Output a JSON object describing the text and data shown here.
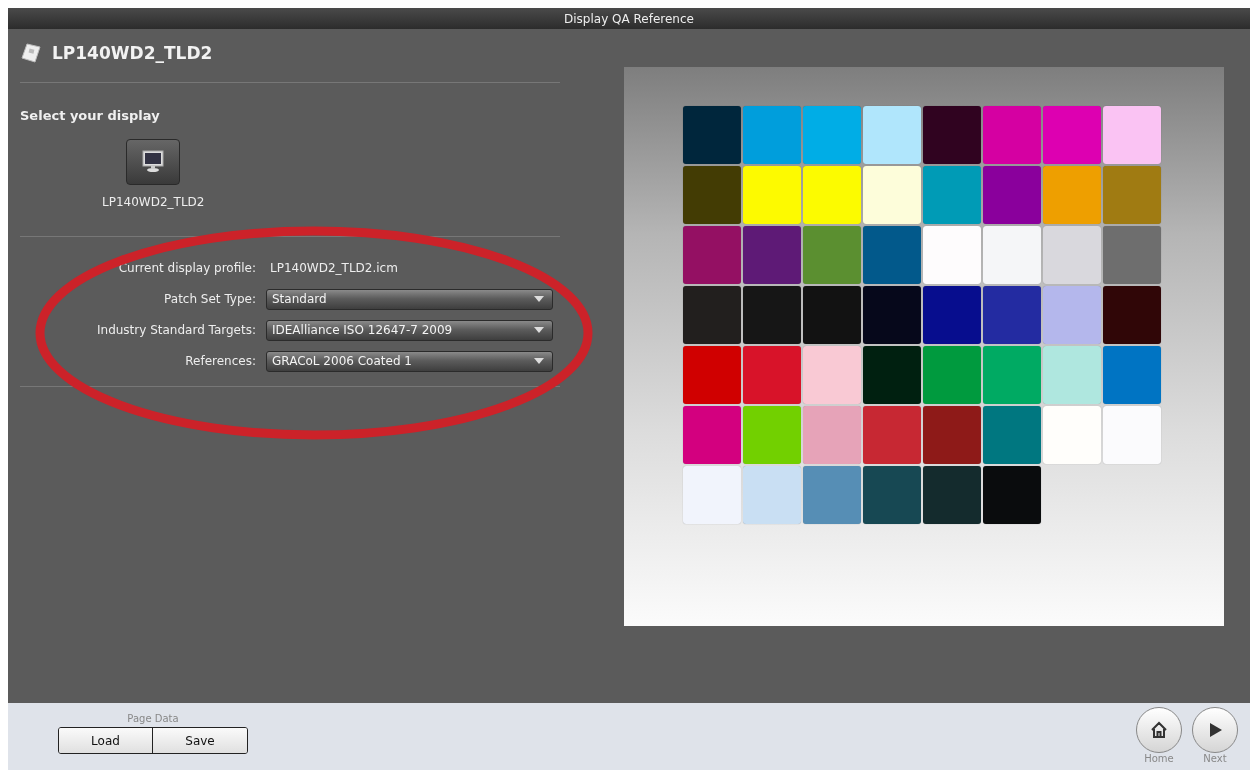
{
  "window": {
    "title": "Display QA Reference"
  },
  "header": {
    "title": "LP140WD2_TLD2"
  },
  "display_select": {
    "heading": "Select your display",
    "displays": [
      {
        "label": "LP140WD2_TLD2",
        "selected": true
      }
    ]
  },
  "settings": {
    "profile_label": "Current display profile:",
    "profile_value": "LP140WD2_TLD2.icm",
    "dropdowns": [
      {
        "label": "Patch Set Type:",
        "value": "Standard"
      },
      {
        "label": "Industry Standard Targets:",
        "value": "IDEAlliance ISO 12647-7 2009"
      },
      {
        "label": "References:",
        "value": "GRACoL 2006 Coated 1"
      }
    ]
  },
  "patches": [
    {
      "color": "#00263c"
    },
    {
      "color": "#009edc"
    },
    {
      "color": "#00ade6"
    },
    {
      "color": "#b0e6fc"
    },
    {
      "color": "#300320"
    },
    {
      "color": "#d500a2"
    },
    {
      "color": "#dd00b1"
    },
    {
      "color": "#fac3f3"
    },
    {
      "color": "#433c04"
    },
    {
      "color": "#fdfa00"
    },
    {
      "color": "#fcfb00"
    },
    {
      "color": "#fdfdda"
    },
    {
      "color": "#009bb6"
    },
    {
      "color": "#8a009c"
    },
    {
      "color": "#ee9f00"
    },
    {
      "color": "#a07b12"
    },
    {
      "color": "#941063"
    },
    {
      "color": "#5e1a76"
    },
    {
      "color": "#5b8f30"
    },
    {
      "color": "#02598b"
    },
    {
      "color": "#fefcfd"
    },
    {
      "color": "#f5f6f8"
    },
    {
      "color": "#d9d8dd"
    },
    {
      "color": "#6e6e6e"
    },
    {
      "color": "#221f1e"
    },
    {
      "color": "#161616"
    },
    {
      "color": "#121212"
    },
    {
      "color": "#06081b"
    },
    {
      "color": "#070d8e"
    },
    {
      "color": "#232ba1"
    },
    {
      "color": "#b4b7ec"
    },
    {
      "color": "#300607"
    },
    {
      "color": "#d00000"
    },
    {
      "color": "#d81329"
    },
    {
      "color": "#f9c9d4"
    },
    {
      "color": "#002010"
    },
    {
      "color": "#009a3e"
    },
    {
      "color": "#00aa63"
    },
    {
      "color": "#afe7df"
    },
    {
      "color": "#0074c3"
    },
    {
      "color": "#d3007f"
    },
    {
      "color": "#72d000"
    },
    {
      "color": "#e6a3b8"
    },
    {
      "color": "#c72833"
    },
    {
      "color": "#8e1a18"
    },
    {
      "color": "#007780"
    },
    {
      "color": "#fffefb"
    },
    {
      "color": "#fbfbfd"
    },
    {
      "color": "#f1f4fc"
    },
    {
      "color": "#c9dff3"
    },
    {
      "color": "#568eb5"
    },
    {
      "color": "#174853"
    },
    {
      "color": "#142b2d"
    },
    {
      "color": "#0a0c0d"
    }
  ],
  "footer": {
    "group_label": "Page Data",
    "buttons": [
      "Load",
      "Save"
    ],
    "nav": [
      {
        "kind": "home",
        "label": "Home"
      },
      {
        "kind": "next",
        "label": "Next"
      }
    ]
  }
}
